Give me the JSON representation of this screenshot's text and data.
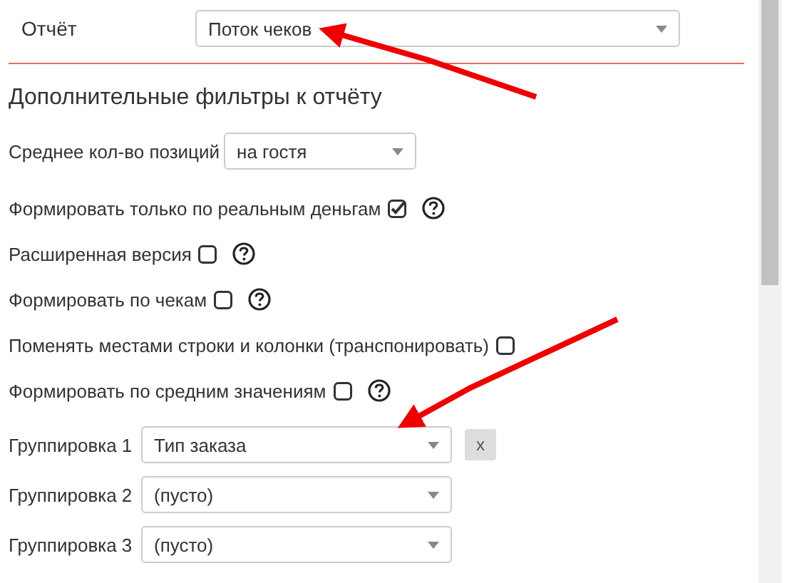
{
  "report": {
    "label": "Отчёт",
    "value": "Поток чеков"
  },
  "heading": "Дополнительные фильтры к отчёту",
  "avg_positions": {
    "label": "Среднее кол-во позиций",
    "value": "на гостя"
  },
  "options": [
    {
      "label": "Формировать только по реальным деньгам",
      "checked": true,
      "help": true
    },
    {
      "label": "Расширенная версия",
      "checked": false,
      "help": true
    },
    {
      "label": "Формировать по чекам",
      "checked": false,
      "help": true
    },
    {
      "label": "Поменять местами строки и колонки (транспонировать)",
      "checked": false,
      "help": false
    },
    {
      "label": "Формировать по средним значениям",
      "checked": false,
      "help": true
    }
  ],
  "groupings": [
    {
      "label": "Группировка 1",
      "value": "Тип заказа",
      "clear": "x"
    },
    {
      "label": "Группировка 2",
      "value": "(пусто)"
    },
    {
      "label": "Группировка 3",
      "value": "(пусто)"
    }
  ]
}
